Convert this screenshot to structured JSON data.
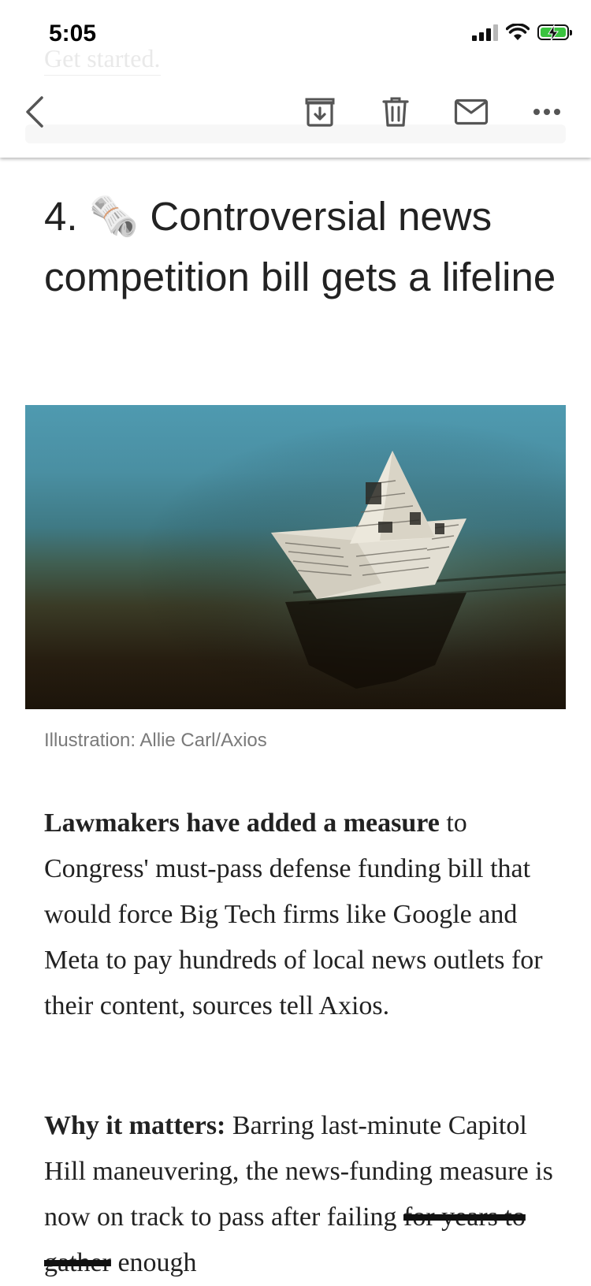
{
  "status_bar": {
    "time": "5:05"
  },
  "behind_text": "Get started.",
  "article": {
    "heading_number": "4.",
    "heading_emoji": "🗞️",
    "heading_text": "Controversial news competition bill gets a lifeline",
    "image_caption": "Illustration: Allie Carl/Axios",
    "paragraph1_lead": "Lawmakers have added a measure",
    "paragraph1_rest": "to Congress' must-pass defense funding bill that would force Big Tech firms like Google and Meta to pay hundreds of local news outlets for their content, sources tell Axios.",
    "paragraph2_lead": "Why it matters:",
    "paragraph2_text": "Barring last-minute Capitol Hill maneuvering, the news-funding measure is now on track to pass after failing",
    "paragraph2_struck": "for years to gather",
    "paragraph2_end": "enough"
  },
  "toolbar": {
    "icons": [
      "back-chevron-icon",
      "archive-icon",
      "trash-icon",
      "mail-icon",
      "more-icon"
    ]
  },
  "colors": {
    "battery": "#3ac33f",
    "sky": "#4f9ab0",
    "water_dark": "#1c140a"
  }
}
